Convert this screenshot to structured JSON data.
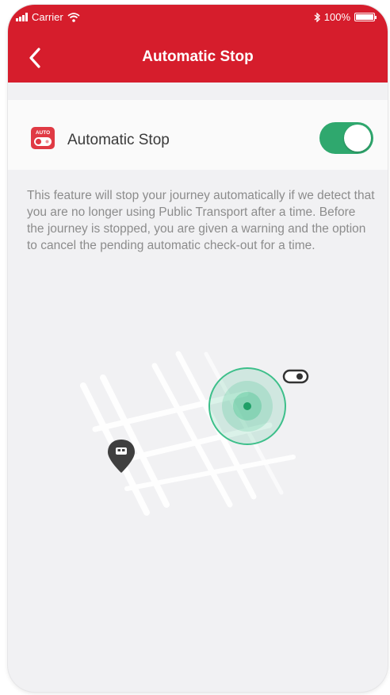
{
  "status_bar": {
    "carrier": "Carrier",
    "battery": "100%",
    "icons": [
      "signal-icon",
      "wifi-icon",
      "bluetooth-icon",
      "battery-icon"
    ]
  },
  "nav": {
    "title": "Automatic Stop",
    "back_icon": "chevron-left-icon"
  },
  "setting": {
    "label": "Automatic Stop",
    "icon_text": "AUTO",
    "enabled": true
  },
  "description": "This feature will stop your journey automatically if we detect that you are no longer using Public Transport after a time. Before the journey is stopped, you are given a warning and the option to cancel the pending automatic check-out for a time.",
  "colors": {
    "brand_red": "#d61d2c",
    "toggle_green": "#2fa86e",
    "location_green": "#3dbf8a",
    "text_dark": "#3a3a3a",
    "text_muted": "#8c8c8c"
  }
}
